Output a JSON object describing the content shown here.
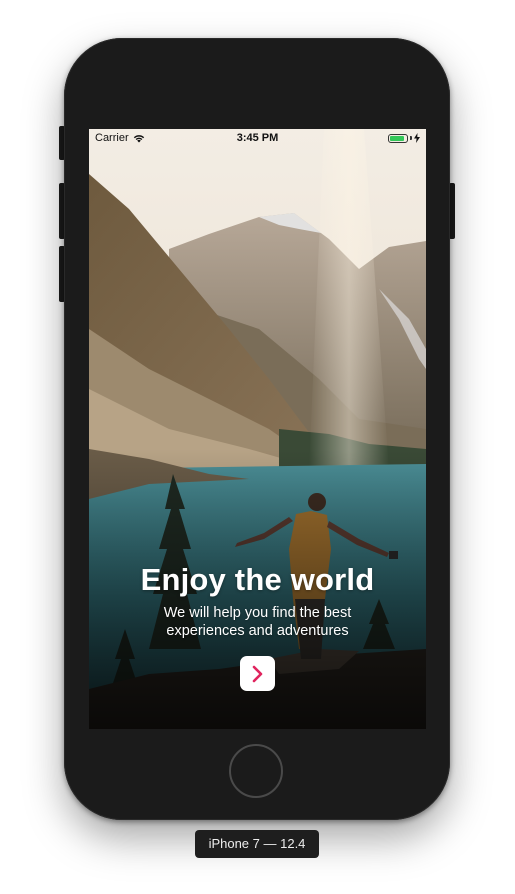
{
  "status_bar": {
    "carrier": "Carrier",
    "time": "3:45 PM",
    "battery_level": 0.85,
    "wifi_icon": "wifi-icon",
    "battery_icon": "battery-icon",
    "charging_icon": "bolt-icon"
  },
  "onboarding": {
    "title": "Enjoy the world",
    "subtitle": "We will help you find the best experiences and adventures",
    "next_icon": "chevron-right-icon",
    "accent_color": "#e0245e"
  },
  "simulator": {
    "device_label": "iPhone 7 — 12.4"
  }
}
